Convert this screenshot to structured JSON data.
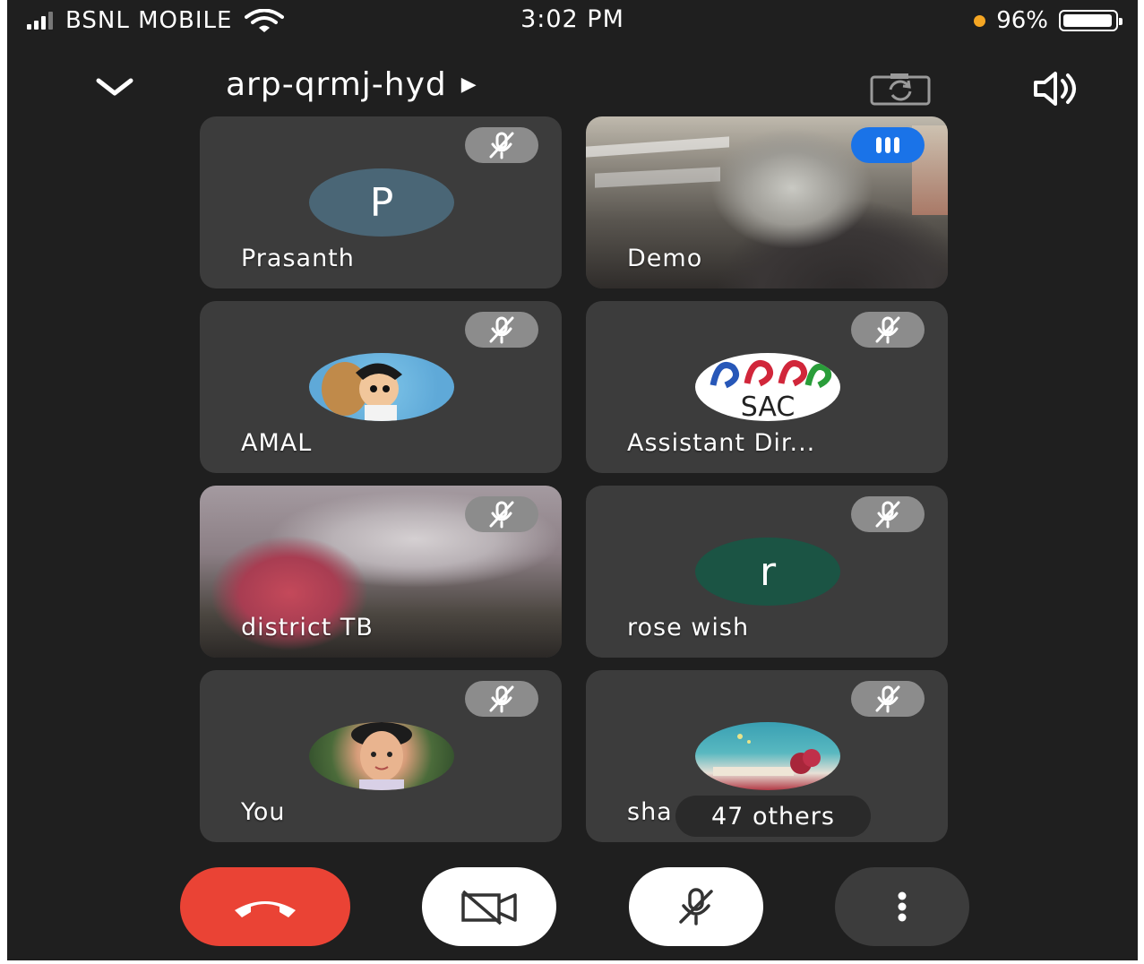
{
  "status_bar": {
    "carrier": "BSNL MOBILE",
    "time": "3:02 PM",
    "battery_percent": "96%",
    "battery_level": 0.96,
    "signal_bars": 3,
    "signal_bars_total": 4,
    "privacy_dot_color": "#f5a623"
  },
  "header": {
    "meeting_code": "arp-qrmj-hyd",
    "collapse_icon": "chevron-down-icon",
    "flip_camera_icon": "flip-camera-icon",
    "speaker_icon": "speaker-icon"
  },
  "participants": [
    {
      "name": "Prasanth",
      "initial": "P",
      "muted": true,
      "avatar_color": "#4a6676"
    },
    {
      "name": "Demo",
      "speaking": true,
      "video": true
    },
    {
      "name": "AMAL",
      "muted": true,
      "avatar": "photo"
    },
    {
      "name": "Assistant Dir...",
      "muted": true,
      "avatar": "logo",
      "logo_text": "SAC"
    },
    {
      "name": "district TB",
      "muted": true,
      "video": true
    },
    {
      "name": "rose wish",
      "initial": "r",
      "muted": true,
      "avatar_color": "#1b5444"
    },
    {
      "name": "You",
      "muted": true,
      "avatar": "photo"
    },
    {
      "name": "sha",
      "muted": true,
      "avatar": "photo",
      "overlay": "47 others"
    }
  ],
  "controls": {
    "end_call_icon": "end-call-icon",
    "camera_icon": "camera-off-icon",
    "mic_icon": "mic-off-icon",
    "more_icon": "more-options-icon"
  },
  "colors": {
    "background": "#1f1f1f",
    "tile": "#3c3c3c",
    "end_call": "#ea4335",
    "speaking": "#1a73e8",
    "mute_badge": "#8c8c8c"
  }
}
